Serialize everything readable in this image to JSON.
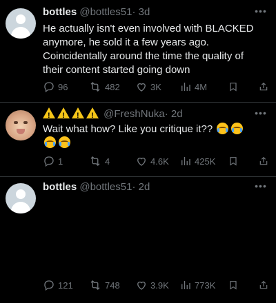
{
  "tweets": [
    {
      "name": "bottles",
      "handle": "@bottles51",
      "time": "· 3d",
      "text": "He actually isn't even involved with BLACKED anymore, he sold it a few years ago. Coincidentally around the time the quality of their content started going down",
      "counts": {
        "replies": "96",
        "reposts": "482",
        "likes": "3K",
        "views": "4M"
      }
    },
    {
      "name_prefix_icons": [
        "warning-icon",
        "warning-icon",
        "warning-icon",
        "warning-icon"
      ],
      "name": "",
      "handle": "@FreshNuka",
      "time": "· 2d",
      "text": "Wait what how? Like you critique it??",
      "emojis": [
        "loudly-crying-face",
        "loudly-crying-face",
        "loudly-crying-face",
        "loudly-crying-face"
      ],
      "counts": {
        "replies": "1",
        "reposts": "4",
        "likes": "4.6K",
        "views": "425K"
      }
    },
    {
      "name": "bottles",
      "handle": "@bottles51",
      "time": "· 2d",
      "text": "",
      "counts": {
        "replies": "121",
        "reposts": "748",
        "likes": "3.9K",
        "views": "773K"
      }
    }
  ],
  "icons": {
    "more": "more-icon",
    "reply": "reply-icon",
    "repost": "repost-icon",
    "like": "heart-icon",
    "views": "views-icon",
    "bookmark": "bookmark-icon",
    "share": "share-icon"
  },
  "colors": {
    "background": "#000000",
    "text": "#e7e9ea",
    "muted": "#71767b",
    "divider": "#2f3336",
    "warning": "#f5c518"
  }
}
